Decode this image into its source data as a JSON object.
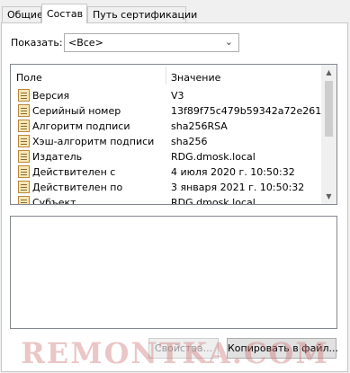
{
  "tabs": [
    {
      "label": "Общие"
    },
    {
      "label": "Состав"
    },
    {
      "label": "Путь сертификации"
    }
  ],
  "show": {
    "label": "Показать:",
    "selected": "<Все>"
  },
  "grid": {
    "columns": [
      "Поле",
      "Значение"
    ],
    "rows": [
      {
        "field": "Версия",
        "value": "V3"
      },
      {
        "field": "Серийный номер",
        "value": "13f89f75c479b59342a72e261..."
      },
      {
        "field": "Алгоритм подписи",
        "value": "sha256RSA"
      },
      {
        "field": "Хэш-алгоритм подписи",
        "value": "sha256"
      },
      {
        "field": "Издатель",
        "value": "RDG.dmosk.local"
      },
      {
        "field": "Действителен с",
        "value": "4 июля 2020 г. 10:50:32"
      },
      {
        "field": "Действителен по",
        "value": "3 января 2021 г. 10:50:32"
      },
      {
        "field": "Субъект",
        "value": "RDG.dmosk.local"
      }
    ]
  },
  "buttons": {
    "properties": "Свойства...",
    "copy": "Копировать в файл..."
  },
  "watermark": "REMONTKA.COM"
}
